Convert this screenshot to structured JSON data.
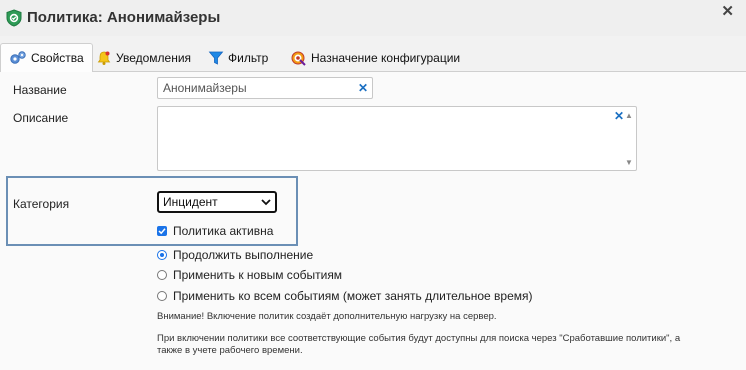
{
  "window": {
    "title": "Политика: Анонимайзеры",
    "close_symbol": "✕",
    "icon": "shield-icon"
  },
  "tabs": [
    {
      "label": "Свойства",
      "icon": "gears-icon",
      "active": true
    },
    {
      "label": "Уведомления",
      "icon": "bell-icon",
      "active": false
    },
    {
      "label": "Фильтр",
      "icon": "funnel-icon",
      "active": false
    },
    {
      "label": "Назначение конфигурации",
      "icon": "target-icon",
      "active": false
    }
  ],
  "form": {
    "name_label": "Название",
    "name_value": "Анонимайзеры",
    "description_label": "Описание",
    "description_value": "",
    "category_label": "Категория",
    "category_value": "Инцидент",
    "active_label": "Политика активна",
    "active_checked": true,
    "options": [
      {
        "label": "Продолжить выполнение",
        "checked": true
      },
      {
        "label": "Применить к новым событиям",
        "checked": false
      },
      {
        "label": "Применить ко всем событиям (может занять длительное время)",
        "checked": false
      }
    ],
    "warning": "Внимание! Включение политик создаёт дополнительную нагрузку на сервер.",
    "info_line1": "При включении политики все соответствующие события будут доступны для поиска через \"Сработавшие политики\", а",
    "info_line2": "также в учете рабочего времени."
  },
  "colors": {
    "accent": "#1a73e8",
    "highlight_border": "#6b8fb5",
    "shield": "#2e9b56"
  }
}
